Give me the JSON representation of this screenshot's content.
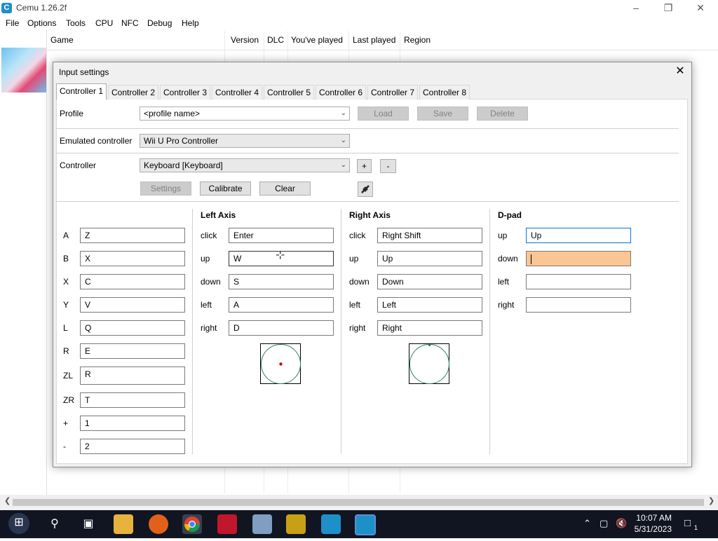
{
  "app": {
    "title": "Cemu 1.26.2f",
    "icon_letter": "C",
    "menu": [
      "File",
      "Options",
      "Tools",
      "CPU",
      "NFC",
      "Debug",
      "Help"
    ],
    "window_buttons": [
      "–",
      "❐",
      "✕"
    ]
  },
  "gamelist": {
    "columns": [
      "Game",
      "Version",
      "DLC",
      "You've played",
      "Last played",
      "Region"
    ]
  },
  "dialog": {
    "title": "Input settings",
    "close": "✕",
    "tabs": [
      "Controller 1",
      "Controller 2",
      "Controller 3",
      "Controller 4",
      "Controller 5",
      "Controller 6",
      "Controller 7",
      "Controller 8"
    ],
    "profile": {
      "label": "Profile",
      "placeholder_value": "<profile name>",
      "load": "Load",
      "save": "Save",
      "delete": "Delete"
    },
    "emulated": {
      "label": "Emulated controller",
      "value": "Wii U Pro Controller"
    },
    "controller": {
      "label": "Controller",
      "value": "Keyboard [Keyboard]",
      "add": "+",
      "remove": "-",
      "settings": "Settings",
      "calibrate": "Calibrate",
      "clear": "Clear"
    },
    "buttons": [
      {
        "label": "A",
        "value": "Z"
      },
      {
        "label": "B",
        "value": "X"
      },
      {
        "label": "X",
        "value": "C"
      },
      {
        "label": "Y",
        "value": "V"
      },
      {
        "label": "L",
        "value": "Q"
      },
      {
        "label": "R",
        "value": "E"
      },
      {
        "label": "ZL",
        "value": "R"
      },
      {
        "label": "ZR",
        "value": "T"
      },
      {
        "label": "+",
        "value": "1"
      },
      {
        "label": "-",
        "value": "2"
      }
    ],
    "left_axis": {
      "title": "Left Axis",
      "rows": [
        {
          "label": "click",
          "value": "Enter"
        },
        {
          "label": "up",
          "value": "W"
        },
        {
          "label": "down",
          "value": "S"
        },
        {
          "label": "left",
          "value": "A"
        },
        {
          "label": "right",
          "value": "D"
        }
      ]
    },
    "right_axis": {
      "title": "Right Axis",
      "rows": [
        {
          "label": "click",
          "value": "Right Shift"
        },
        {
          "label": "up",
          "value": "Up"
        },
        {
          "label": "down",
          "value": "Down"
        },
        {
          "label": "left",
          "value": "Left"
        },
        {
          "label": "right",
          "value": "Right"
        }
      ]
    },
    "dpad": {
      "title": "D-pad",
      "rows": [
        {
          "label": "up",
          "value": "Up"
        },
        {
          "label": "down",
          "value": ""
        },
        {
          "label": "left",
          "value": ""
        },
        {
          "label": "right",
          "value": ""
        }
      ]
    }
  },
  "taskbar": {
    "time": "10:07 AM",
    "date": "5/31/2023",
    "notification_count": "1"
  },
  "colors": {
    "active_field": "#fbc693",
    "focus_border": "#0078d7",
    "taskbar": "#101521"
  }
}
